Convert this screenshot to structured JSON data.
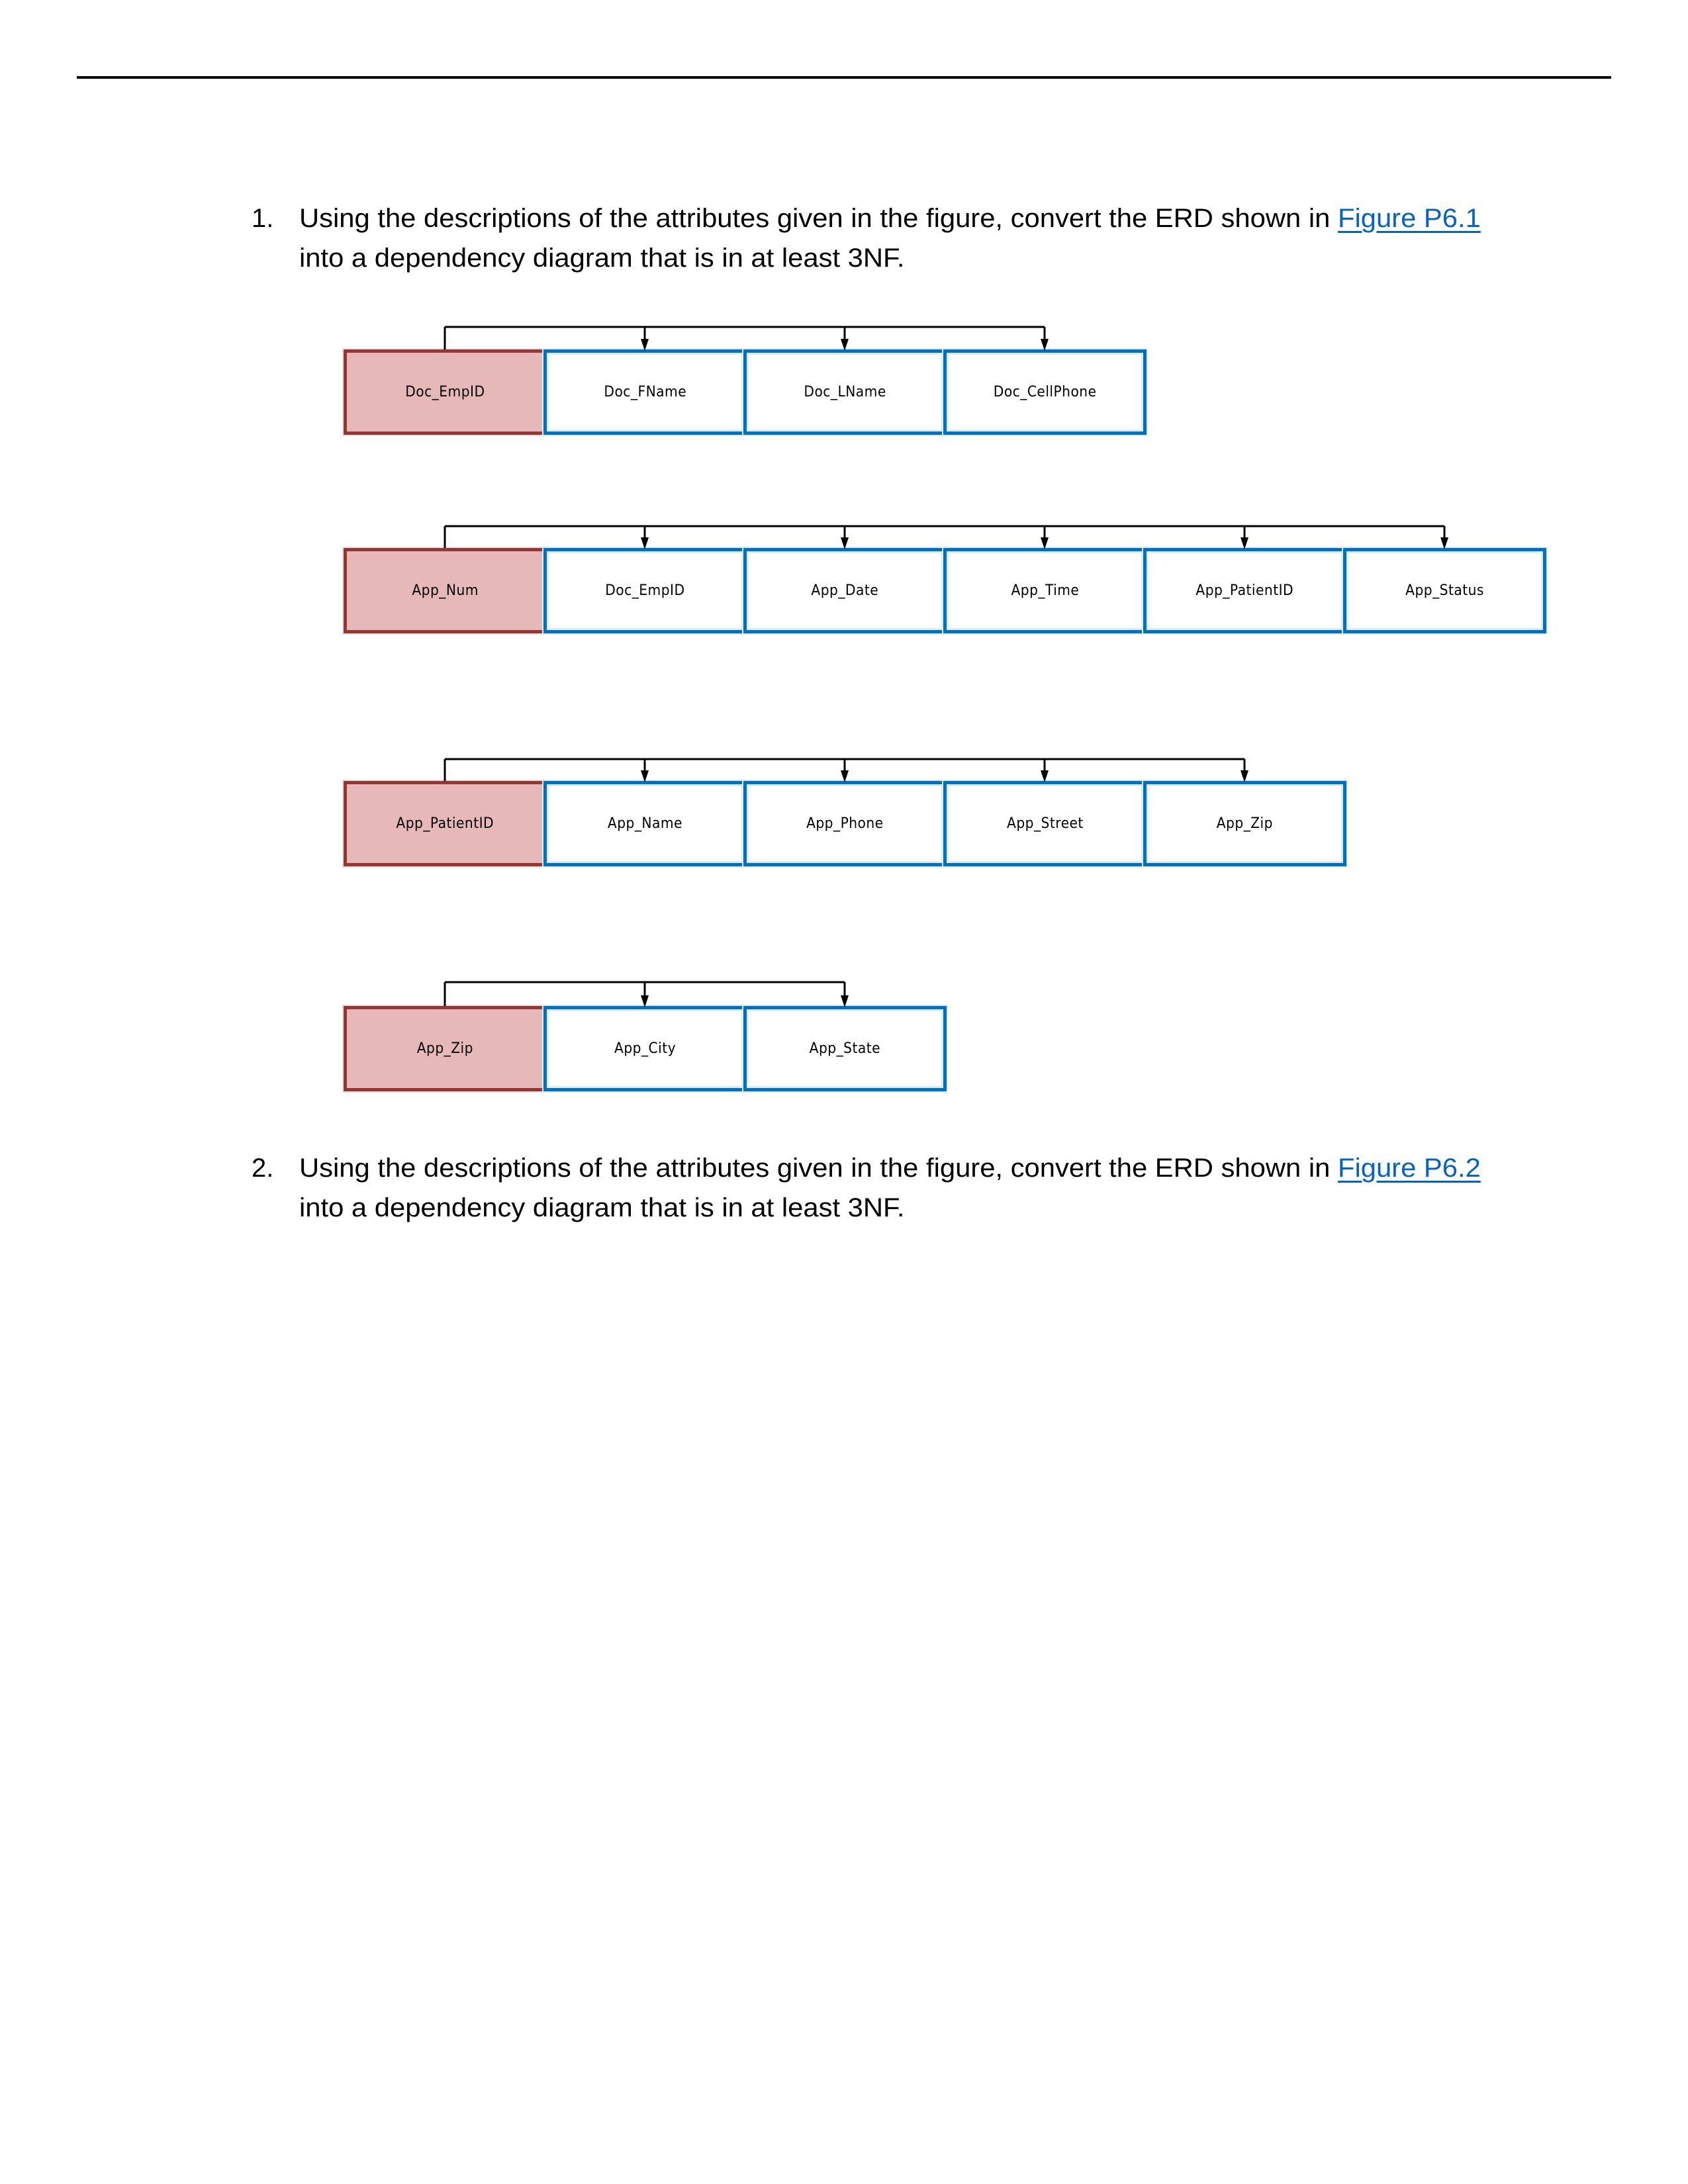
{
  "questions": [
    {
      "number": "1.",
      "line1_text": "Using the descriptions of the attributes given in the figure, convert the ERD shown in ",
      "line1_link": "Figure P6.1",
      "line2_text": "into a dependency diagram that is in at least 3NF."
    },
    {
      "number": "2.",
      "line1_text": "Using the descriptions of the attributes given in the figure, convert the ERD shown in ",
      "line1_link": "Figure P6.2",
      "line2_text": "into a dependency diagram that is in at least 3NF."
    }
  ],
  "colors": {
    "primary_key_fill": "#E6B8B7",
    "primary_key_border": "#943634",
    "attribute_border": "#0070C0",
    "link": "#0563C1"
  },
  "dependency_diagrams": [
    {
      "primary_key": "Doc_EmpID",
      "attributes": [
        "Doc_FName",
        "Doc_LName",
        "Doc_CellPhone"
      ]
    },
    {
      "primary_key": "App_Num",
      "attributes": [
        "Doc_EmpID",
        "App_Date",
        "App_Time",
        "App_PatientID",
        "App_Status"
      ]
    },
    {
      "primary_key": "App_PatientID",
      "attributes": [
        "App_Name",
        "App_Phone",
        "App_Street",
        "App_Zip"
      ]
    },
    {
      "primary_key": "App_Zip",
      "attributes": [
        "App_City",
        "App_State"
      ]
    }
  ]
}
